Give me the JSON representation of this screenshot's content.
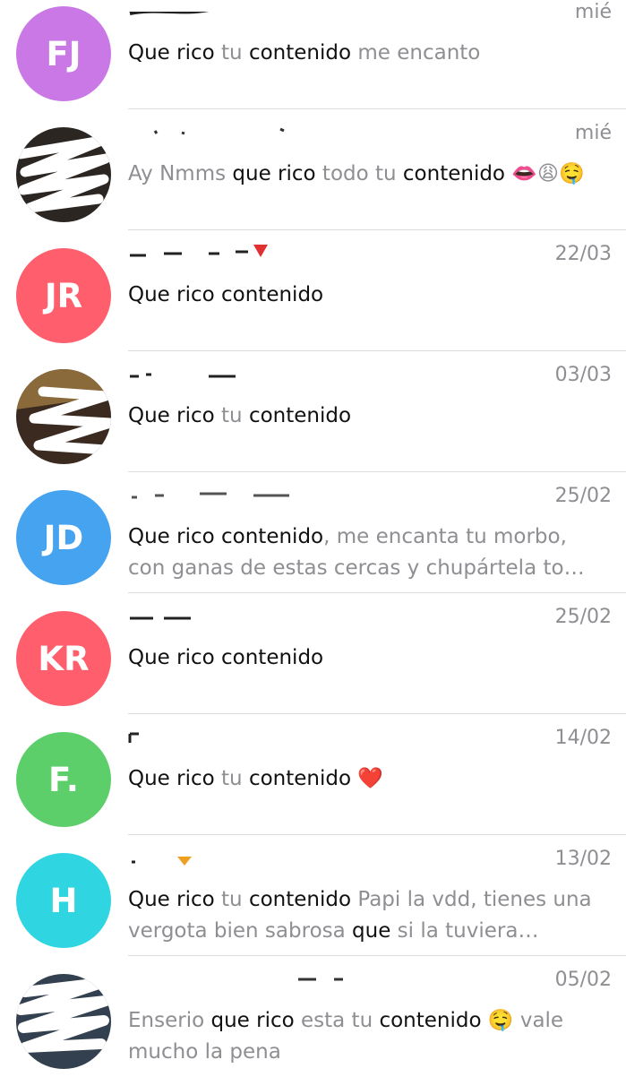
{
  "colors": {
    "separator": "#dcdcdc",
    "muted_text": "#8e8e93",
    "highlight_text": "#111111"
  },
  "chats": [
    {
      "initials": "FJ",
      "avatar_color": "#c978e6",
      "name": "",
      "date": "mié",
      "segments": [
        {
          "t": "Que rico",
          "h": true
        },
        {
          "t": " tu ",
          "h": false
        },
        {
          "t": "contenido",
          "h": true
        },
        {
          "t": " me encanto",
          "h": false
        }
      ]
    },
    {
      "initials": "",
      "avatar_color": "#2b2622",
      "photo": true,
      "name": "",
      "date": "mié",
      "segments": [
        {
          "t": "Ay Nmms ",
          "h": false
        },
        {
          "t": "que rico",
          "h": true
        },
        {
          "t": " todo tu ",
          "h": false
        },
        {
          "t": "contenido",
          "h": true
        },
        {
          "t": " 👄😩🤤",
          "h": false
        }
      ]
    },
    {
      "initials": "JR",
      "avatar_color": "#ff5f6d",
      "name": "",
      "date": "22/03",
      "segments": [
        {
          "t": "Que rico contenido",
          "h": true
        }
      ]
    },
    {
      "initials": "",
      "avatar_color": "#3a2a20",
      "photo": true,
      "name": "",
      "date": "03/03",
      "segments": [
        {
          "t": "Que rico",
          "h": true
        },
        {
          "t": " tu ",
          "h": false
        },
        {
          "t": "contenido",
          "h": true
        }
      ]
    },
    {
      "initials": "JD",
      "avatar_color": "#46a3f0",
      "name": "",
      "date": "25/02",
      "segments": [
        {
          "t": "Que rico contenido",
          "h": true
        },
        {
          "t": ", me encanta tu morbo, con ganas de estas cercas y chupártela to…",
          "h": false
        }
      ]
    },
    {
      "initials": "KR",
      "avatar_color": "#ff5f6d",
      "name": "",
      "date": "25/02",
      "segments": [
        {
          "t": "Que rico contenido",
          "h": true
        }
      ]
    },
    {
      "initials": "F.",
      "avatar_color": "#5ccf6a",
      "name": "",
      "date": "14/02",
      "segments": [
        {
          "t": "Que rico",
          "h": true
        },
        {
          "t": " tu ",
          "h": false
        },
        {
          "t": "contenido",
          "h": true
        },
        {
          "t": " ❤️",
          "h": false
        }
      ]
    },
    {
      "initials": "H",
      "avatar_color": "#2fd6e2",
      "name": "",
      "date": "13/02",
      "segments": [
        {
          "t": "Que rico",
          "h": true
        },
        {
          "t": " tu ",
          "h": false
        },
        {
          "t": "contenido",
          "h": true
        },
        {
          "t": " Papi la vdd, tienes una vergota bien sabrosa ",
          "h": false
        },
        {
          "t": "que",
          "h": true
        },
        {
          "t": " si la tuviera…",
          "h": false
        }
      ]
    },
    {
      "initials": "",
      "avatar_color": "#33404f",
      "photo": true,
      "name": "",
      "date": "05/02",
      "segments": [
        {
          "t": "Enserio ",
          "h": false
        },
        {
          "t": "que rico",
          "h": true
        },
        {
          "t": " esta tu ",
          "h": false
        },
        {
          "t": "contenido",
          "h": true
        },
        {
          "t": " 🤤 vale mucho la pena",
          "h": false
        }
      ]
    }
  ]
}
